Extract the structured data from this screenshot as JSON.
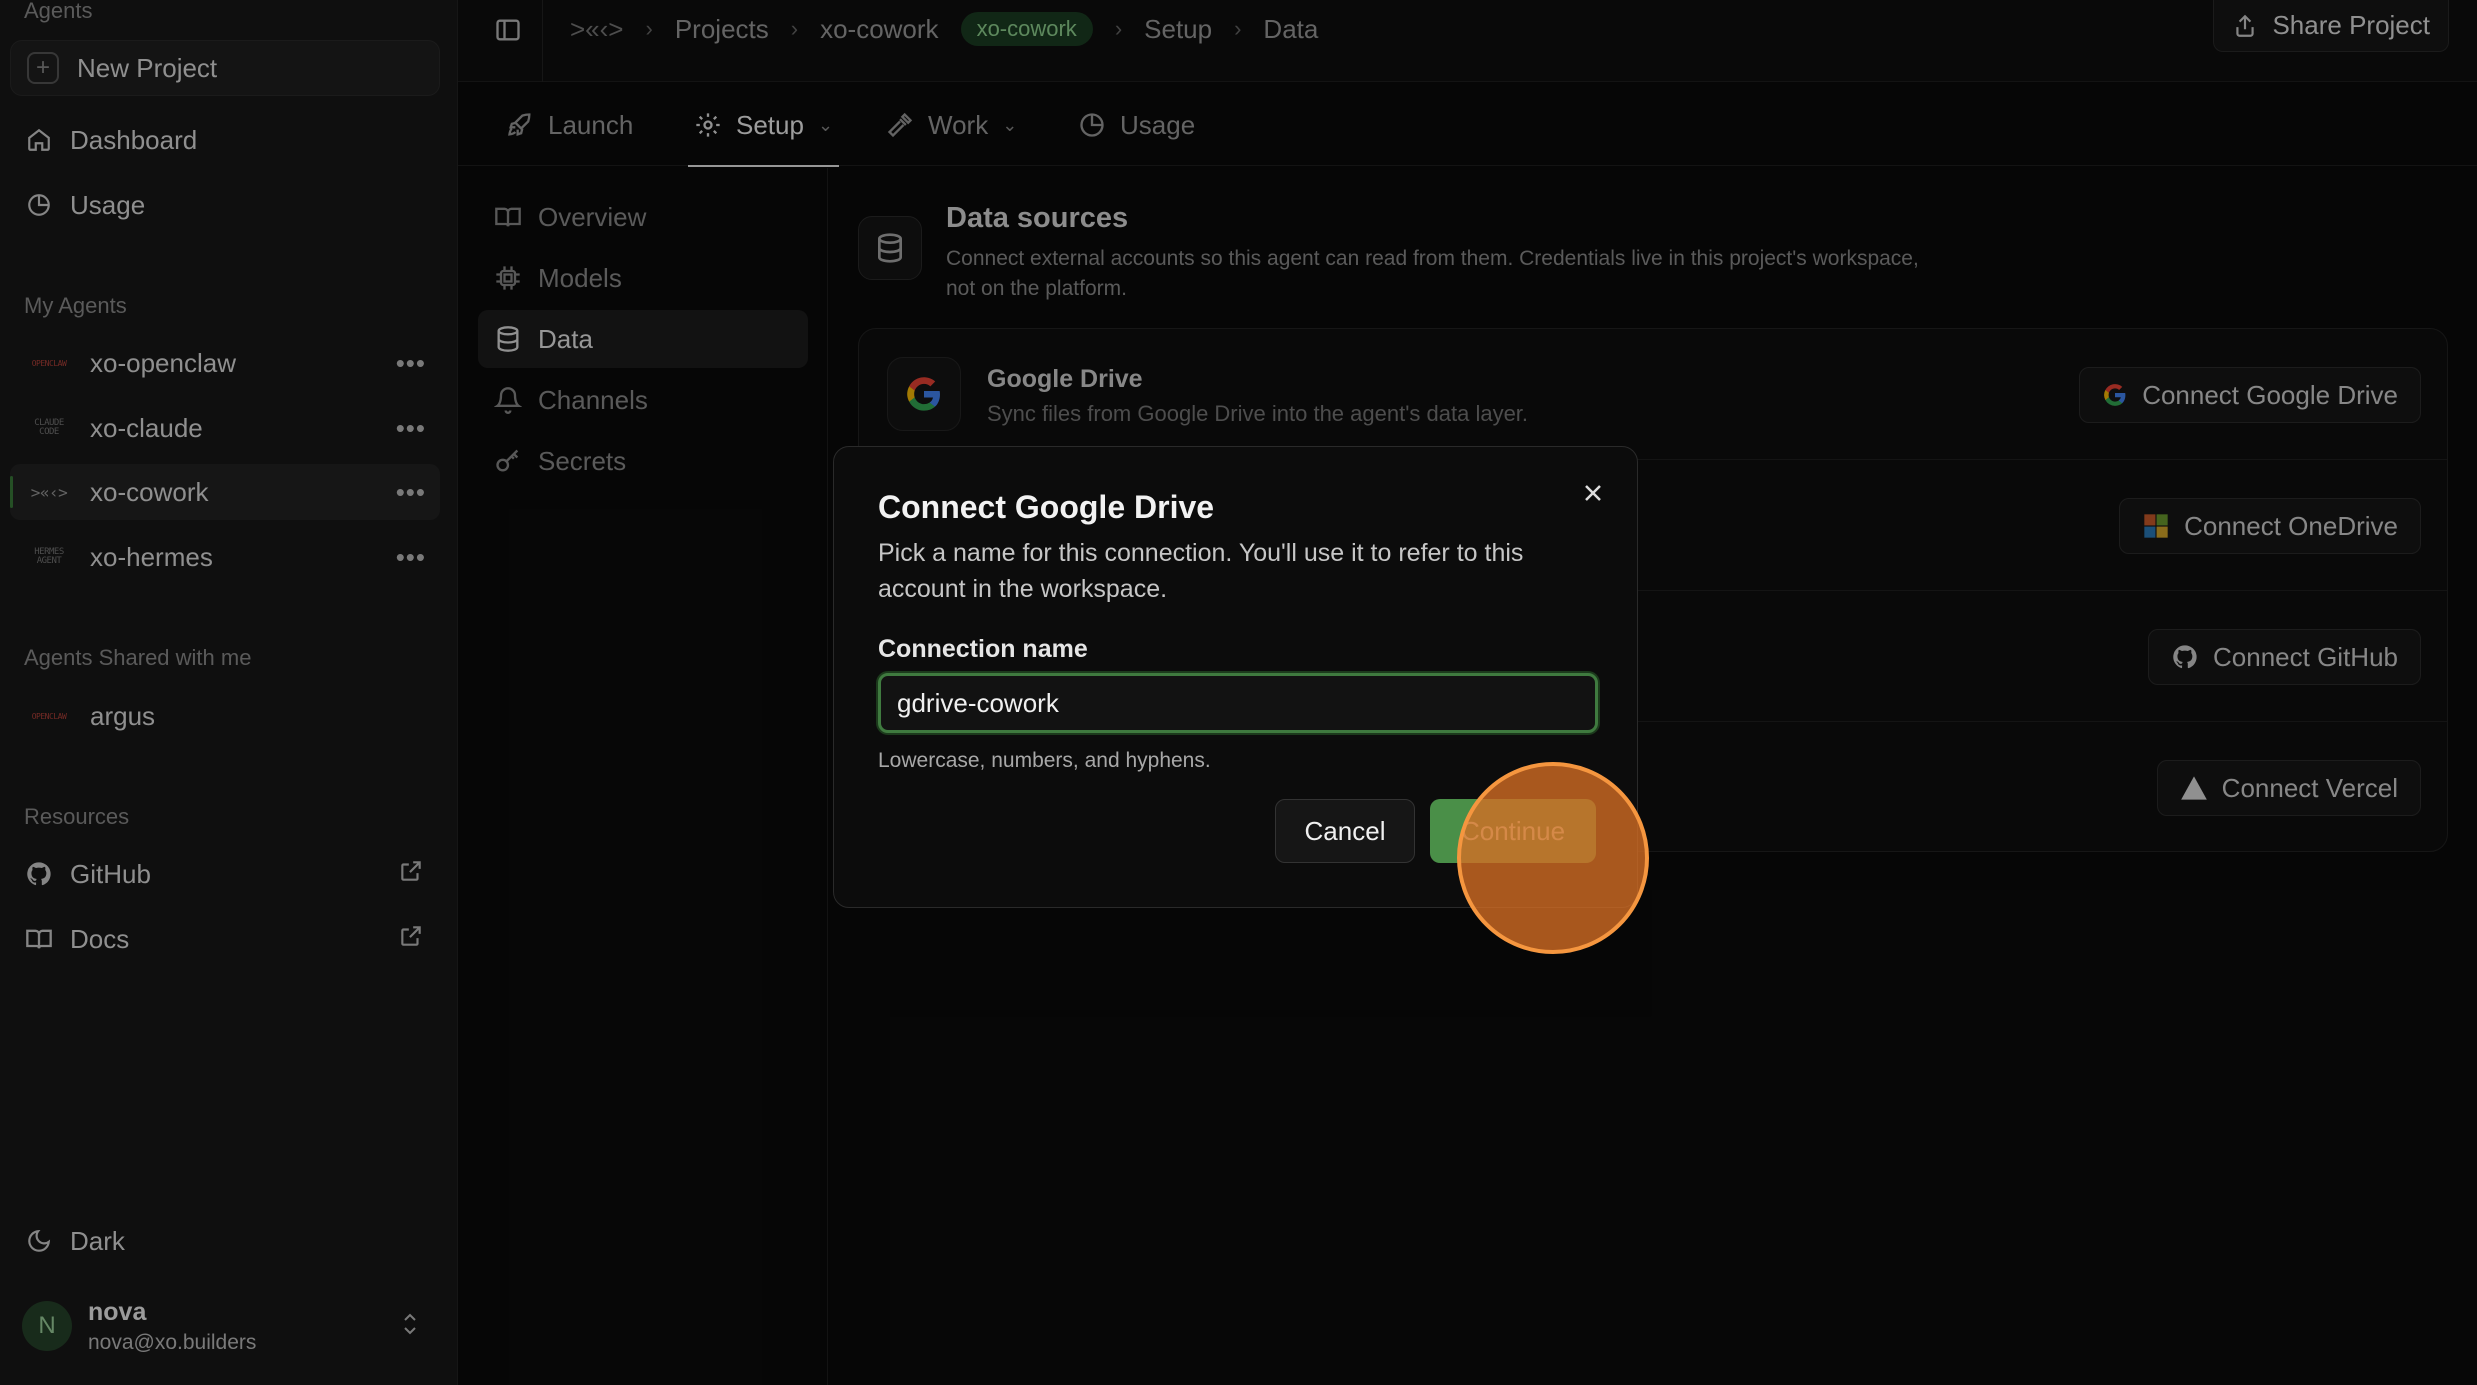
{
  "sidebar": {
    "agents_heading": "Agents",
    "new_project": "New Project",
    "nav": [
      {
        "label": "Dashboard",
        "icon": "home-icon"
      },
      {
        "label": "Usage",
        "icon": "pie-chart-icon"
      }
    ],
    "my_agents_heading": "My Agents",
    "my_agents": [
      {
        "label": "xo-openclaw",
        "logo": "OPENCLAW"
      },
      {
        "label": "xo-claude",
        "logo": "CLAUDE CODE"
      },
      {
        "label": "xo-cowork",
        "logo": ">«‹>",
        "active": true
      },
      {
        "label": "xo-hermes",
        "logo": "HERMES AGENT"
      }
    ],
    "shared_heading": "Agents Shared with me",
    "shared_agents": [
      {
        "label": "argus",
        "logo": "OPENCLAW"
      }
    ],
    "resources_heading": "Resources",
    "resources": [
      {
        "label": "GitHub",
        "icon": "github-icon"
      },
      {
        "label": "Docs",
        "icon": "book-icon"
      }
    ],
    "theme_label": "Dark",
    "user": {
      "initial": "N",
      "name": "nova",
      "email": "nova@xo.builders"
    }
  },
  "topbar": {
    "logo": ">«‹>",
    "breadcrumbs": [
      "Projects",
      "xo-cowork",
      "Setup",
      "Data"
    ],
    "badge": "xo-cowork",
    "share_label": "Share Project"
  },
  "tabs": [
    {
      "label": "Launch",
      "icon": "rocket-icon"
    },
    {
      "label": "Setup",
      "icon": "gear-icon",
      "active": true
    },
    {
      "label": "Work",
      "icon": "hammer-icon"
    },
    {
      "label": "Usage",
      "icon": "pie-chart-icon"
    }
  ],
  "subnav": [
    {
      "label": "Overview",
      "icon": "book-icon"
    },
    {
      "label": "Models",
      "icon": "cpu-icon"
    },
    {
      "label": "Data",
      "icon": "database-icon",
      "active": true
    },
    {
      "label": "Channels",
      "icon": "bell-icon"
    },
    {
      "label": "Secrets",
      "icon": "key-icon"
    }
  ],
  "main": {
    "title": "Data sources",
    "description": "Connect external accounts so this agent can read from them. Credentials live in this project's workspace, not on the platform.",
    "sources": [
      {
        "title": "Google Drive",
        "desc": "Sync files from Google Drive into the agent's data layer.",
        "button": "Connect Google Drive"
      },
      {
        "title": "",
        "desc": "",
        "button": "Connect OneDrive"
      },
      {
        "title": "",
        "desc": "",
        "button": "Connect GitHub"
      },
      {
        "title": "",
        "desc": "",
        "button": "Connect Vercel"
      }
    ]
  },
  "modal": {
    "title": "Connect Google Drive",
    "description": "Pick a name for this connection. You'll use it to refer to this account in the workspace.",
    "field_label": "Connection name",
    "field_value": "gdrive-cowork",
    "hint": "Lowercase, numbers, and hyphens.",
    "cancel": "Cancel",
    "continue": "Continue"
  },
  "colors": {
    "accent_green": "#4a8f48",
    "badge_bg": "#1b3d22",
    "click_marker": "#f5963f"
  }
}
